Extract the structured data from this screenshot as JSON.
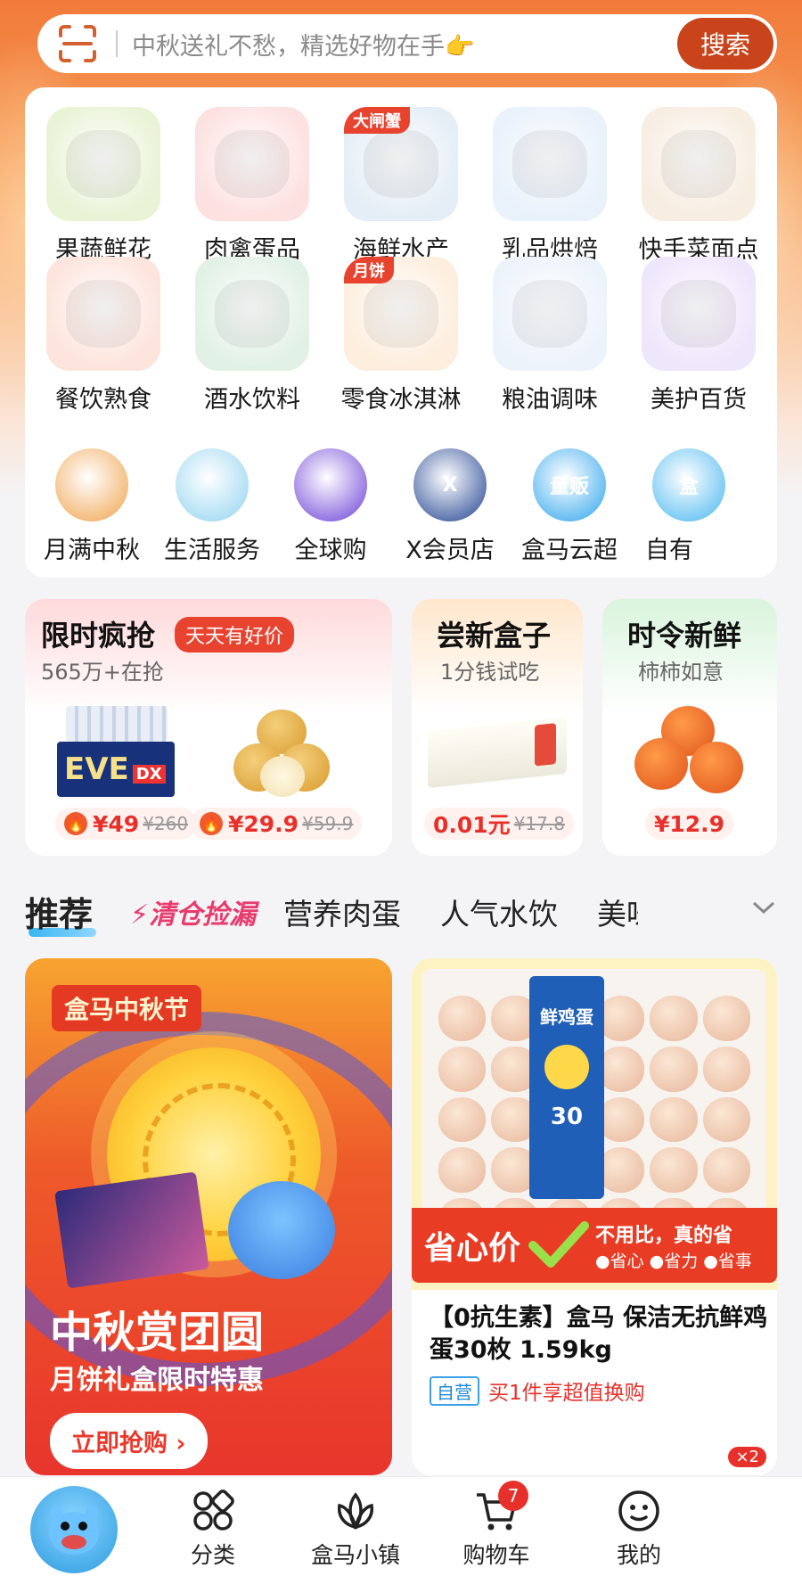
{
  "search": {
    "placeholder": "中秋送礼不愁，精选好物在手👉",
    "button_label": "搜索"
  },
  "categories": [
    {
      "label": "果蔬鲜花",
      "tag": "",
      "icon": "fruit-vegetable-icon",
      "color": "#e9f3d6"
    },
    {
      "label": "肉禽蛋品",
      "tag": "",
      "icon": "meat-icon",
      "color": "#fde1e1"
    },
    {
      "label": "海鲜水产",
      "tag": "大闸蟹",
      "icon": "seafood-icon",
      "color": "#e5eef6"
    },
    {
      "label": "乳品烘焙",
      "tag": "",
      "icon": "dairy-icon",
      "color": "#e9f1fb"
    },
    {
      "label": "快手菜面点",
      "tag": "",
      "icon": "quick-meal-icon",
      "color": "#f7ede1"
    },
    {
      "label": "餐饮熟食",
      "tag": "",
      "icon": "cooked-food-icon",
      "color": "#fde4dd"
    },
    {
      "label": "酒水饮料",
      "tag": "",
      "icon": "drinks-icon",
      "color": "#e2f1e6"
    },
    {
      "label": "零食冰淇淋",
      "tag": "月饼",
      "icon": "snack-icon",
      "color": "#fdeedd"
    },
    {
      "label": "粮油调味",
      "tag": "",
      "icon": "grain-oil-icon",
      "color": "#edf3fb"
    },
    {
      "label": "美护百货",
      "tag": "",
      "icon": "beauty-icon",
      "color": "#eee6fb"
    }
  ],
  "round_items": [
    {
      "label": "月满中秋",
      "icon": "mid-autumn-rabbit-icon",
      "text": "",
      "color": "#f0a24a"
    },
    {
      "label": "生活服务",
      "icon": "service-staff-icon",
      "text": "",
      "color": "#8fd3f0"
    },
    {
      "label": "全球购",
      "icon": "global-planet-icon",
      "text": "",
      "color": "#6b3fd6"
    },
    {
      "label": "X会员店",
      "icon": "x-member-icon",
      "text": "X",
      "color": "#1c3f8e"
    },
    {
      "label": "盒马云超",
      "icon": "cloud-market-icon",
      "text": "量贩",
      "color": "#2aa3ec"
    },
    {
      "label": "自有",
      "icon": "own-brand-icon",
      "text": "盒",
      "color": "#46b6f0"
    }
  ],
  "promos": {
    "flash": {
      "title": "限时疯抢",
      "badge": "天天有好价",
      "sub": "565万+在抢",
      "items": [
        {
          "price": "¥49",
          "old": "¥260"
        },
        {
          "price": "¥29.9",
          "old": "¥59.9"
        }
      ]
    },
    "trial": {
      "title": "尝新盒子",
      "sub": "1分钱试吃",
      "price": "0.01元",
      "old": "¥17.8"
    },
    "fresh": {
      "title": "时令新鲜",
      "sub": "柿柿如意",
      "price": "¥12.9"
    }
  },
  "tabs": {
    "items": [
      "推荐",
      "⚡清仓捡漏",
      "营养肉蛋",
      "人气水饮",
      "美味"
    ]
  },
  "feed": {
    "left": {
      "festival_tag": "盒马中秋节",
      "headline": "中秋赏团圆",
      "subline": "月饼礼盒限时特惠",
      "button": "立即抢购 ›"
    },
    "right": {
      "banner_main": "省心价",
      "banner_side_title": "不用比，真的省",
      "banner_side_points": "●省心 ●省力 ●省事",
      "egg_label": "鲜鸡蛋",
      "egg_count": "30",
      "title": "【0抗生素】盒马 保洁无抗鲜鸡蛋30枚 1.59kg",
      "tag_self": "自营",
      "tag_promo": "买1件享超值换购",
      "qty": "×2"
    }
  },
  "bottom_nav": {
    "items": [
      {
        "label": "分类",
        "icon": "category-grid-icon"
      },
      {
        "label": "盒马小镇",
        "icon": "lotus-town-icon"
      },
      {
        "label": "购物车",
        "icon": "cart-icon",
        "badge": "7"
      },
      {
        "label": "我的",
        "icon": "profile-face-icon"
      }
    ]
  },
  "colors": {
    "brand_red": "#c9441b",
    "price_red": "#e8302a",
    "accent_blue": "#38b6f0"
  }
}
